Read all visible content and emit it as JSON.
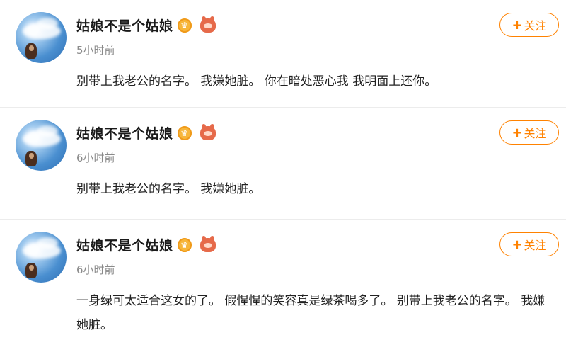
{
  "posts": [
    {
      "username": "姑娘不是个姑娘",
      "time": "5小时前",
      "content": "别带上我老公的名字。  我嫌她脏。 你在暗处恶心我  我明面上还你。",
      "follow_label": "关注",
      "follow_plus": "+"
    },
    {
      "username": "姑娘不是个姑娘",
      "time": "6小时前",
      "content": "别带上我老公的名字。  我嫌她脏。",
      "follow_label": "关注",
      "follow_plus": "+"
    },
    {
      "username": "姑娘不是个姑娘",
      "time": "6小时前",
      "content": "一身绿可太适合这女的了。 假惺惺的笑容真是绿茶喝多了。 别带上我老公的名字。 我嫌她脏。",
      "follow_label": "关注",
      "follow_plus": "+"
    }
  ],
  "icons": {
    "avatar": "avatar-image",
    "crown_badge": "crown-badge-icon",
    "pet_badge": "pet-badge-icon"
  },
  "colors": {
    "accent": "#ff8200",
    "time": "#8a8a8a",
    "divider": "#ececec"
  }
}
